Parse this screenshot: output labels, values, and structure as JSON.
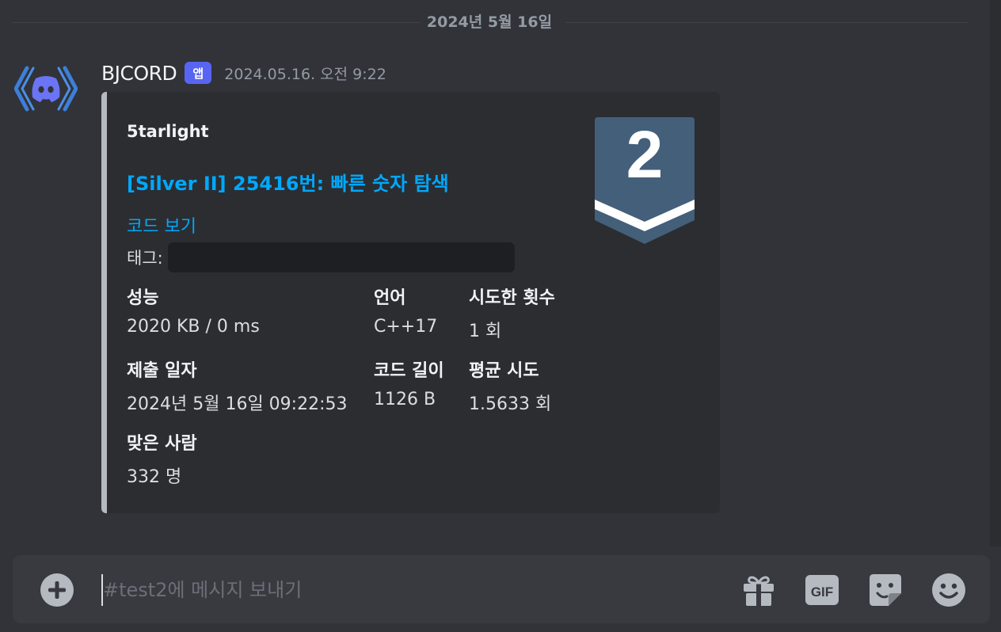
{
  "date_divider": "2024년 5월 16일",
  "message": {
    "username": "BJCORD",
    "app_badge": "앱",
    "timestamp": "2024.05.16. 오전 9:22"
  },
  "embed": {
    "accent_color": "#b5bac1",
    "link_color": "#00a8fc",
    "author": "5tarlight",
    "title": "[Silver II] 25416번: 빠른 숫자 탐색",
    "code_link": "코드 보기",
    "tags_label": "태그:",
    "tier_number": "2",
    "tier_badge_color": "#435f7a",
    "fields": [
      {
        "name": "성능",
        "value": "2020 KB / 0 ms"
      },
      {
        "name": "언어",
        "value": "C++17"
      },
      {
        "name": "시도한 횟수",
        "value": "1 회"
      },
      {
        "name": "제출 일자",
        "value": "2024년 5월 16일 09:22:53"
      },
      {
        "name": "코드 길이",
        "value": "1126 B"
      },
      {
        "name": "평균 시도",
        "value": "1.5633 회"
      },
      {
        "name": "맞은 사람",
        "value": "332 명"
      }
    ]
  },
  "composer": {
    "placeholder": "#test2에 메시지 보내기",
    "gif_label": "GIF",
    "icons": [
      "plus-circle-icon",
      "gift-icon",
      "gif-icon",
      "sticker-icon",
      "emoji-icon"
    ]
  }
}
